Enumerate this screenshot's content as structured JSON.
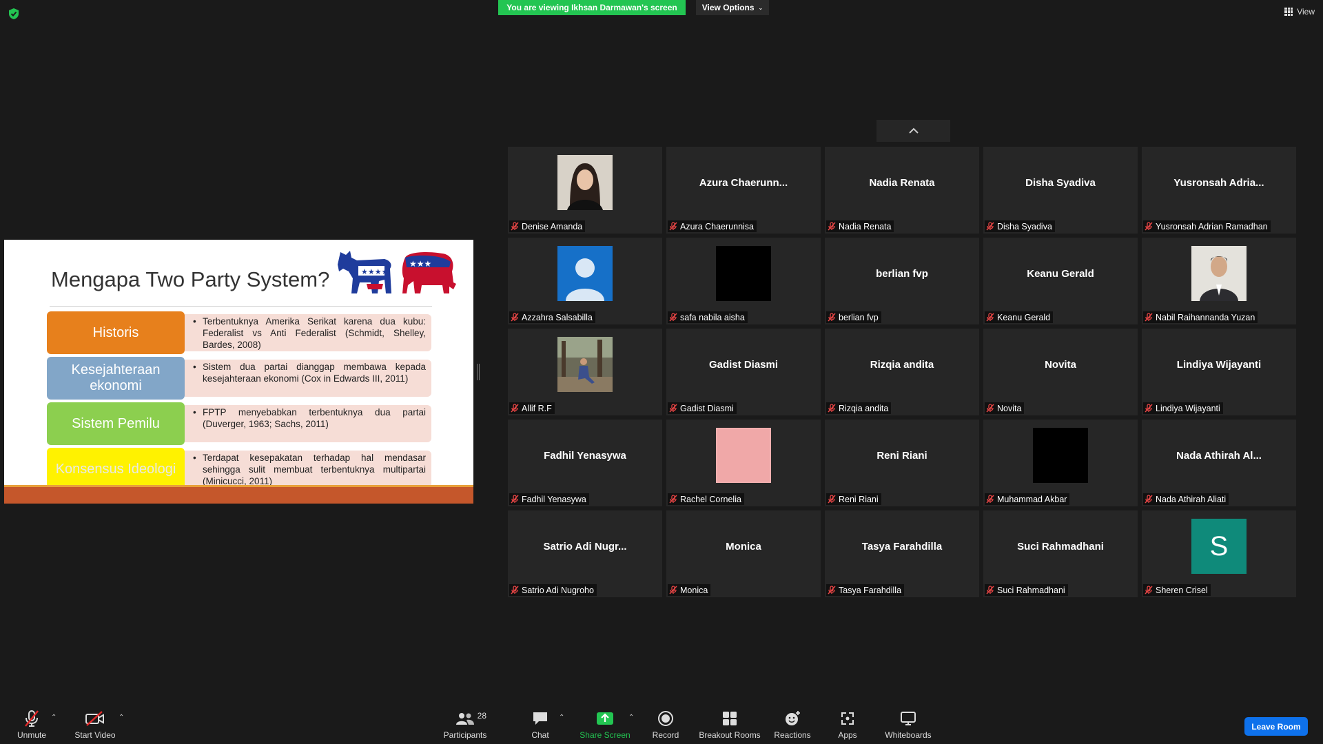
{
  "top": {
    "banner": "You are viewing Ikhsan Darmawan's screen",
    "view_options": "View Options",
    "view": "View",
    "banner_color": "#23c552"
  },
  "slide": {
    "title": "Mengapa Two Party System?",
    "rows": [
      {
        "key": "Historis",
        "value": "Terbentuknya Amerika Serikat karena dua kubu: Federalist vs Anti Federalist (Schmidt, Shelley, Bardes, 2008)",
        "color": "#e7801c"
      },
      {
        "key": "Kesejahteraan ekonomi",
        "value": "Sistem dua partai dianggap membawa kepada kesejahteraan ekonomi (Cox in Edwards III, 2011)",
        "color": "#82a6c8"
      },
      {
        "key": "Sistem Pemilu",
        "value": "FPTP menyebabkan terbentuknya dua partai (Duverger, 1963; Sachs, 2011)",
        "color": "#8ccf4f"
      },
      {
        "key": "Konsensus Ideologi",
        "value": "Terdapat kesepakatan terhadap hal mendasar sehingga sulit membuat terbentuknya multipartai (Minicucci, 2011)",
        "color": "#fff200"
      }
    ]
  },
  "participants": [
    {
      "display": "",
      "label": "Denise Amanda",
      "avatar": "photo-woman"
    },
    {
      "display": "Azura  Chaerunn...",
      "label": "Azura Chaerunnisa"
    },
    {
      "display": "Nadia Renata",
      "label": "Nadia Renata"
    },
    {
      "display": "Disha Syadiva",
      "label": "Disha Syadiva"
    },
    {
      "display": "Yusronsah  Adria...",
      "label": "Yusronsah Adrian Ramadhan"
    },
    {
      "display": "",
      "label": "Azzahra Salsabilla",
      "avatar": "default-person"
    },
    {
      "display": "",
      "label": "safa nabila aisha",
      "avatar": "black"
    },
    {
      "display": "berlian fvp",
      "label": "berlian fvp"
    },
    {
      "display": "Keanu Gerald",
      "label": "Keanu Gerald"
    },
    {
      "display": "",
      "label": "Nabil Raihannanda Yuzan",
      "avatar": "photo-man"
    },
    {
      "display": "",
      "label": "Allif R.F",
      "avatar": "photo-outdoor"
    },
    {
      "display": "Gadist Diasmi",
      "label": "Gadist Diasmi"
    },
    {
      "display": "Rizqia andita",
      "label": "Rizqia andita"
    },
    {
      "display": "Novita",
      "label": "Novita"
    },
    {
      "display": "Lindiya Wijayanti",
      "label": "Lindiya Wijayanti"
    },
    {
      "display": "Fadhil Yenasywa",
      "label": "Fadhil Yenasywa"
    },
    {
      "display": "",
      "label": "Rachel Cornelia",
      "avatar": "pink"
    },
    {
      "display": "Reni Riani",
      "label": "Reni Riani"
    },
    {
      "display": "",
      "label": "Muhammad Akbar",
      "avatar": "black"
    },
    {
      "display": "Nada Athirah  Al...",
      "label": "Nada Athirah Aliati"
    },
    {
      "display": "Satrio  Adi  Nugr...",
      "label": "Satrio Adi Nugroho"
    },
    {
      "display": "Monica",
      "label": "Monica"
    },
    {
      "display": "Tasya Farahdilla",
      "label": "Tasya Farahdilla"
    },
    {
      "display": "Suci Rahmadhani",
      "label": "Suci Rahmadhani"
    },
    {
      "display": "",
      "label": "Sheren Crisel",
      "avatar": "letter",
      "letter": "S",
      "letter_color": "#0f8a7a"
    }
  ],
  "toolbar": {
    "unmute": "Unmute",
    "start_video": "Start Video",
    "participants": "Participants",
    "participants_count": "28",
    "chat": "Chat",
    "share_screen": "Share Screen",
    "record": "Record",
    "breakout_rooms": "Breakout Rooms",
    "reactions": "Reactions",
    "apps": "Apps",
    "whiteboards": "Whiteboards",
    "leave_room": "Leave Room",
    "share_color": "#23c552",
    "leave_color": "#0e71eb"
  }
}
